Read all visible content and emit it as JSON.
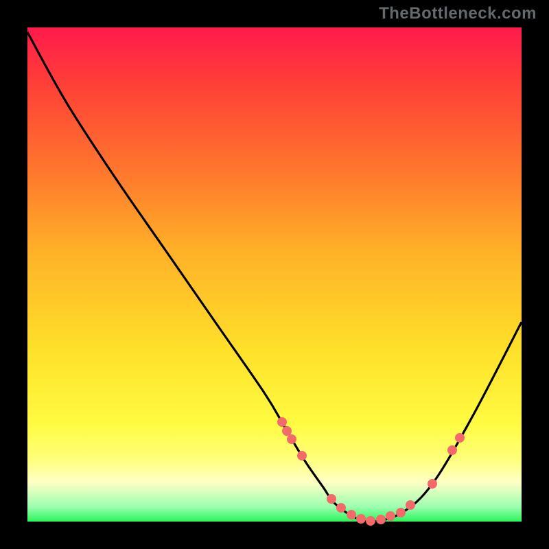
{
  "attribution": "TheBottleneck.com",
  "chart_data": {
    "type": "line",
    "title": "",
    "xlabel": "",
    "ylabel": "",
    "x": [
      0.0,
      0.08,
      0.18,
      0.28,
      0.38,
      0.48,
      0.52,
      0.56,
      0.6,
      0.62,
      0.66,
      0.7,
      0.76,
      0.82,
      0.9,
      1.0
    ],
    "values": [
      1.03,
      0.88,
      0.72,
      0.57,
      0.42,
      0.27,
      0.2,
      0.13,
      0.07,
      0.04,
      0.01,
      0.0,
      0.02,
      0.08,
      0.22,
      0.42
    ],
    "xlim": [
      0,
      1
    ],
    "ylim": [
      0,
      1.04
    ],
    "points_on_curve_x": [
      0.515,
      0.525,
      0.535,
      0.555,
      0.615,
      0.635,
      0.655,
      0.675,
      0.695,
      0.715,
      0.735,
      0.755,
      0.775,
      0.82,
      0.86,
      0.875
    ],
    "gradient_bands": [
      "#ff1a4b",
      "#ff7a2d",
      "#ffe029",
      "#ffff76",
      "#2af55b"
    ]
  }
}
